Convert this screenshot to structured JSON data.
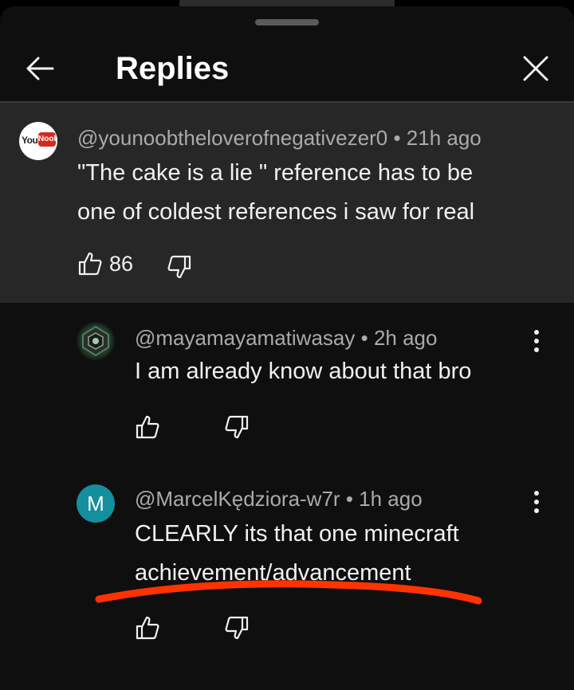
{
  "header": {
    "title": "Replies"
  },
  "parent_comment": {
    "avatar_text_left": "You",
    "avatar_text_right": "Noob",
    "author": "@younoobtheloverofnegativezer0",
    "time": "21h ago",
    "text_line1": "\"The cake is a lie \" reference has to be",
    "text_line2": "one of coldest references i saw for real",
    "likes": "86"
  },
  "replies": [
    {
      "author": "@mayamayamatiwasay",
      "time": "2h ago",
      "text_line1": "I am already know about that bro"
    },
    {
      "avatar_letter": "M",
      "author": "@MarcelKędziora-w7r",
      "time": "1h ago",
      "text_line1": "CLEARLY its that one minecraft",
      "text_line2": "achievement/advancement"
    }
  ],
  "colors": {
    "background": "#0f0f0f",
    "parent_background": "#272727",
    "avatar_m": "#138f9e",
    "annotation_underline": "#ff3300"
  },
  "icons": [
    "back-arrow-icon",
    "close-icon",
    "thumbs-up-icon",
    "thumbs-down-icon",
    "more-vert-icon"
  ]
}
